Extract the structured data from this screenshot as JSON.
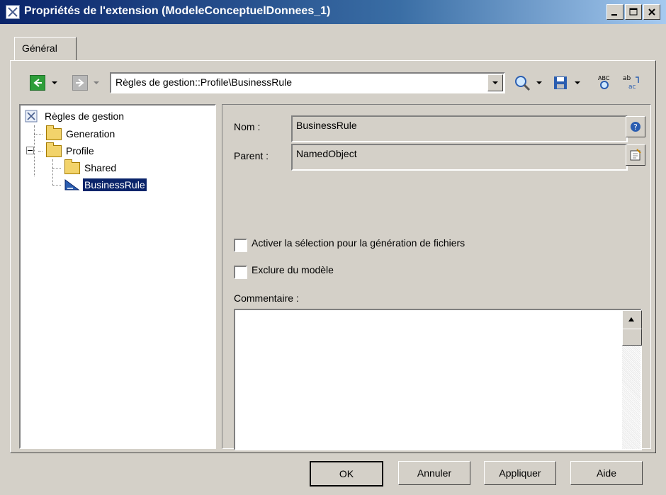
{
  "window": {
    "title": "Propriétés de l'extension (ModeleConceptuelDonnees_1)",
    "controls": [
      "minimize",
      "maximize",
      "close"
    ]
  },
  "tabs": [
    {
      "label": "Général",
      "active": true
    }
  ],
  "toolbar": {
    "path": "Règles de gestion::Profile\\BusinessRule",
    "icons": [
      "back-icon",
      "forward-icon",
      "find-icon",
      "save-icon",
      "spell-check-icon",
      "replace-icon"
    ]
  },
  "tree": {
    "root": "Règles de gestion",
    "items": [
      {
        "label": "Generation",
        "level": 1
      },
      {
        "label": "Profile",
        "level": 1,
        "expanded": true
      },
      {
        "label": "Shared",
        "level": 2
      },
      {
        "label": "BusinessRule",
        "level": 2,
        "selected": true
      }
    ]
  },
  "form": {
    "name_label": "Nom :",
    "name_value": "BusinessRule",
    "parent_label": "Parent :",
    "parent_value": "NamedObject",
    "checkbox_generation_label": "Activer la sélection pour la génération de fichiers",
    "checkbox_generation_checked": false,
    "checkbox_exclude_label": "Exclure du modèle",
    "checkbox_exclude_checked": false,
    "comment_label": "Commentaire :",
    "comment_value": ""
  },
  "buttons": {
    "ok": "OK",
    "cancel": "Annuler",
    "apply": "Appliquer",
    "help": "Aide"
  },
  "colors": {
    "titlebar_start": "#0a246a",
    "titlebar_end": "#a6caf0",
    "dialog_bg": "#d4d0c8",
    "selection": "#0a246a"
  }
}
